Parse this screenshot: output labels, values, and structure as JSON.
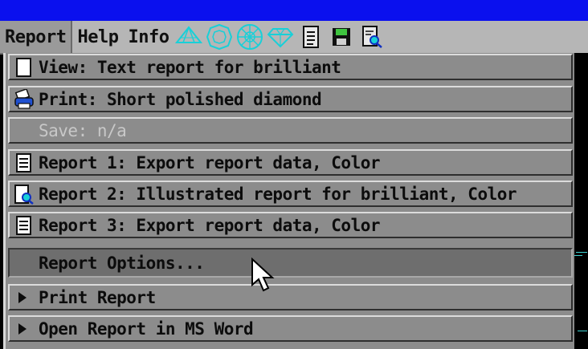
{
  "menubar": {
    "items": [
      {
        "label": "Report",
        "active": true
      },
      {
        "label": "Help",
        "active": false
      },
      {
        "label": "Info",
        "active": false
      }
    ],
    "toolbar_icons": [
      "diamond-pavilion-icon",
      "diamond-round-top-icon",
      "diamond-star-facets-icon",
      "diamond-gem-icon",
      "report-document-icon",
      "save-floppy-icon",
      "print-preview-icon"
    ]
  },
  "dropdown": {
    "items": [
      {
        "label": "View: Text report for brilliant",
        "icon": "blank-page-icon",
        "disabled": false
      },
      {
        "label": "Print: Short polished diamond",
        "icon": "printer-icon",
        "disabled": false
      },
      {
        "label": "Save: n/a",
        "icon": "",
        "disabled": true
      },
      {
        "label": "Report 1: Export report data, Color",
        "icon": "text-document-icon",
        "disabled": false
      },
      {
        "label": "Report 2: Illustrated report for brilliant, Color",
        "icon": "magnify-document-icon",
        "disabled": false
      },
      {
        "label": "Report 3: Export report data, Color",
        "icon": "text-document-icon",
        "disabled": false
      },
      {
        "label": "Report Options...",
        "icon": "",
        "disabled": false,
        "highlight": true
      },
      {
        "label": "Print Report",
        "icon": "submenu-arrow-icon",
        "disabled": false
      },
      {
        "label": "Open Report in MS Word",
        "icon": "submenu-arrow-icon",
        "disabled": false
      }
    ]
  },
  "colors": {
    "titlebar": "#0a10ee",
    "menu_bg": "#8c8c8c",
    "toolbar_accent": "#18d0d8"
  }
}
